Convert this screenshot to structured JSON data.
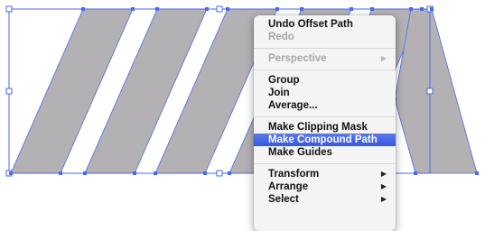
{
  "colors": {
    "shape_fill": "#b3b1b3",
    "selection_blue": "#4a6ae8",
    "menu_bg": "#f4f4f4",
    "highlight": "#3b5bdf"
  },
  "context_menu": {
    "groups": [
      [
        {
          "label": "Undo Offset Path",
          "enabled": true
        },
        {
          "label": "Redo",
          "enabled": false
        }
      ],
      [
        {
          "label": "Perspective",
          "enabled": false,
          "submenu": true
        }
      ],
      [
        {
          "label": "Group",
          "enabled": true
        },
        {
          "label": "Join",
          "enabled": true
        },
        {
          "label": "Average...",
          "enabled": true
        }
      ],
      [
        {
          "label": "Make Clipping Mask",
          "enabled": true
        },
        {
          "label": "Make Compound Path",
          "enabled": true,
          "highlighted": true
        },
        {
          "label": "Make Guides",
          "enabled": true
        }
      ],
      [
        {
          "label": "Transform",
          "enabled": true,
          "submenu": true
        },
        {
          "label": "Arrange",
          "enabled": true,
          "submenu": true
        },
        {
          "label": "Select",
          "enabled": true,
          "submenu": true
        }
      ]
    ],
    "submenu_icon": "triangle-right-icon"
  }
}
